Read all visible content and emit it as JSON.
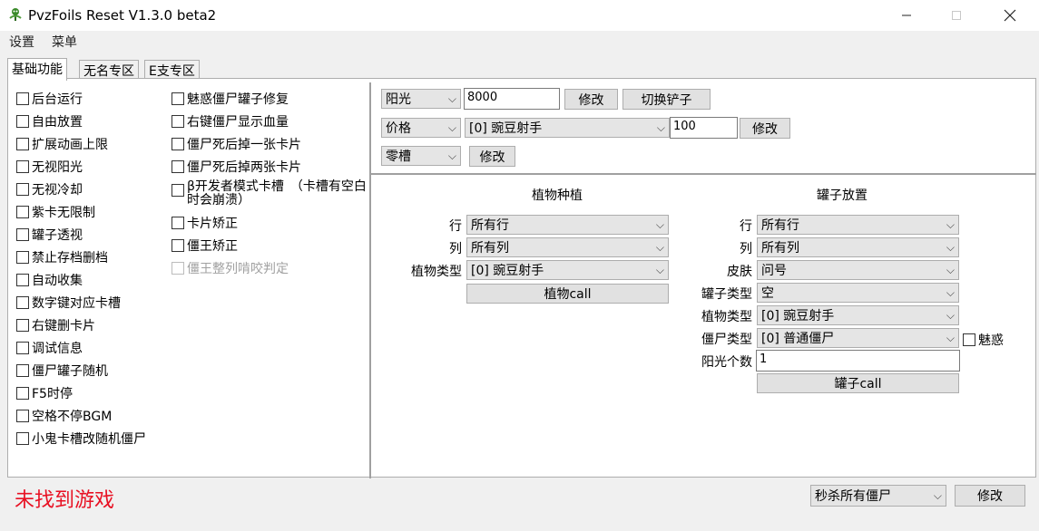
{
  "window": {
    "title": "PvzFoils Reset V1.3.0 beta2"
  },
  "menu": [
    "设置",
    "菜单"
  ],
  "tabs": [
    "基础功能",
    "无名专区",
    "E支专区"
  ],
  "left_options_col1": [
    "后台运行",
    "自由放置",
    "扩展动画上限",
    "无视阳光",
    "无视冷却",
    "紫卡无限制",
    "罐子透视",
    "禁止存档删档",
    "自动收集",
    "数字键对应卡槽",
    "右键删卡片",
    "调试信息",
    "僵尸罐子随机",
    "F5时停",
    "空格不停BGM",
    "小鬼卡槽改随机僵尸"
  ],
  "left_options_col2": [
    {
      "label": "魅惑僵尸罐子修复"
    },
    {
      "label": "右键僵尸显示血量"
    },
    {
      "label": "僵尸死后掉一张卡片"
    },
    {
      "label": "僵尸死后掉两张卡片"
    },
    {
      "label": "β开发者模式卡槽　（卡槽有空白时会崩溃）"
    },
    {
      "label": "卡片矫正"
    },
    {
      "label": "僵王矫正"
    },
    {
      "label": "僵王整列啃咬判定"
    }
  ],
  "top_controls": {
    "row1": {
      "select": "阳光",
      "value": "8000",
      "modify": "修改",
      "switch_shovel": "切换铲子"
    },
    "row2": {
      "select": "价格",
      "plant": "[0] 豌豆射手",
      "value": "100",
      "modify": "修改"
    },
    "row3": {
      "select": "零槽",
      "modify": "修改"
    }
  },
  "plant_section": {
    "title": "植物种植",
    "row_label": "行",
    "row_value": "所有行",
    "col_label": "列",
    "col_value": "所有列",
    "type_label": "植物类型",
    "type_value": "[0] 豌豆射手",
    "button": "植物call"
  },
  "jar_section": {
    "title": "罐子放置",
    "row_label": "行",
    "row_value": "所有行",
    "col_label": "列",
    "col_value": "所有列",
    "skin_label": "皮肤",
    "skin_value": "问号",
    "jar_type_label": "罐子类型",
    "jar_type_value": "空",
    "plant_type_label": "植物类型",
    "plant_type_value": "[0] 豌豆射手",
    "zombie_type_label": "僵尸类型",
    "zombie_type_value": "[0] 普通僵尸",
    "charm_label": "魅惑",
    "sun_label": "阳光个数",
    "sun_value": "1",
    "button": "罐子call"
  },
  "bottom": {
    "status": "未找到游戏",
    "action_select": "秒杀所有僵尸",
    "modify": "修改"
  },
  "colors": {
    "status": "#e81123",
    "accent_bg": "#e1e1e1"
  }
}
